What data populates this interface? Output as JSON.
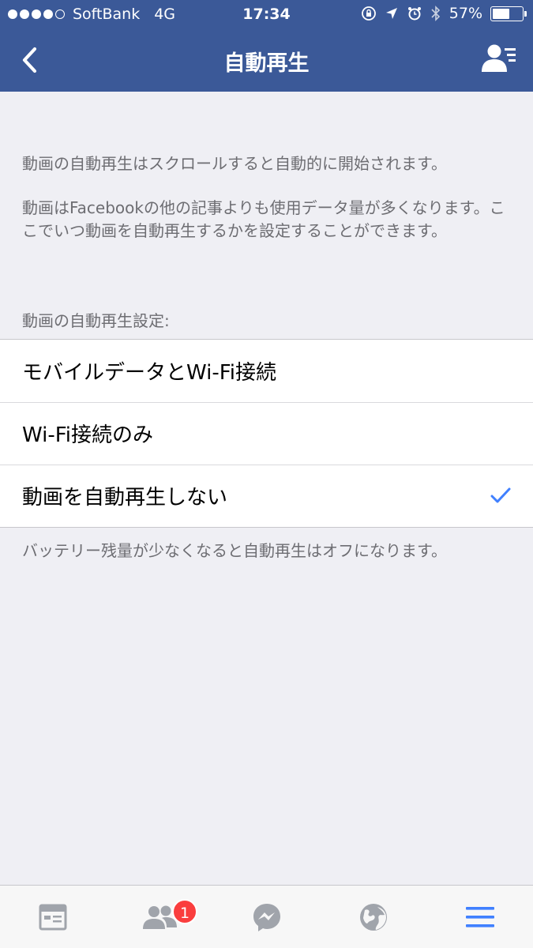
{
  "status_bar": {
    "carrier": "SoftBank",
    "network": "4G",
    "time": "17:34",
    "battery_percent": "57%",
    "battery_level": 0.57,
    "signal_bars": 4,
    "icons": [
      "orientation-lock-icon",
      "location-arrow-icon",
      "alarm-icon",
      "bluetooth-icon",
      "battery-icon"
    ]
  },
  "nav": {
    "title": "自動再生",
    "back_icon": "chevron-left-icon",
    "right_icon": "profile-list-icon"
  },
  "description": {
    "line1": "動画の自動再生はスクロールすると自動的に開始されます。",
    "line2": "動画はFacebookの他の記事よりも使用データ量が多くなります。ここでいつ動画を自動再生するかを設定することができます。"
  },
  "settings": {
    "header": "動画の自動再生設定:",
    "options": [
      {
        "label": "モバイルデータとWi-Fi接続",
        "selected": false
      },
      {
        "label": "Wi-Fi接続のみ",
        "selected": false
      },
      {
        "label": "動画を自動再生しない",
        "selected": true
      }
    ],
    "footer": "バッテリー残量が少なくなると自動再生はオフになります。"
  },
  "tabbar": {
    "tabs": [
      {
        "name": "news-feed",
        "icon": "news-feed-icon"
      },
      {
        "name": "friend-requests",
        "icon": "friends-icon",
        "badge": "1"
      },
      {
        "name": "messenger",
        "icon": "messenger-icon"
      },
      {
        "name": "notifications",
        "icon": "globe-icon"
      },
      {
        "name": "more",
        "icon": "menu-icon",
        "active": true
      }
    ]
  },
  "colors": {
    "brand": "#3b5998",
    "accent": "#4080ff",
    "badge": "#fa3e3e",
    "inactive_tab": "#a0a4ab"
  }
}
